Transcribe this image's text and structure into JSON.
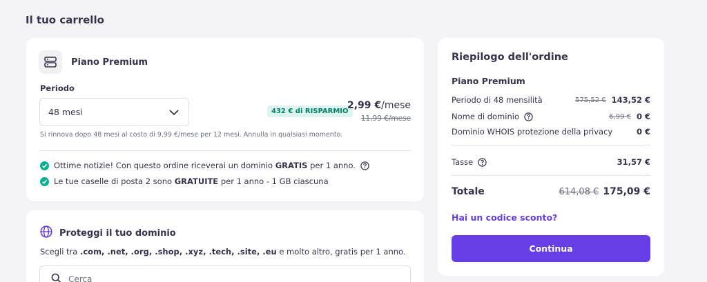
{
  "page": {
    "title": "Il tuo carrello"
  },
  "plan": {
    "name": "Piano Premium",
    "period_label": "Periodo",
    "period_value": "48 mesi",
    "savings_badge": "432 € di RISPARMIO",
    "price": "2,99 €",
    "price_unit": "/mese",
    "old_price": "11,99 €/mese",
    "renew_note": "Si rinnova dopo 48 mesi al costo di 9,99 €/mese per 12 mesi. Annulla in qualsiasi momento.",
    "perks": [
      {
        "pre": "Ottime notizie! Con questo ordine riceverai un dominio ",
        "bold": "GRATIS",
        "post": " per 1 anno."
      },
      {
        "pre": "Le tue caselle di posta 2 sono ",
        "bold": "GRATUITE",
        "post": " per 1 anno - 1 GB ciascuna"
      }
    ]
  },
  "domain": {
    "title": "Proteggi il tuo dominio",
    "desc_pre": "Scegli tra ",
    "desc_bold": ".com, .net, .org, .shop, .xyz, .tech, .site, .eu",
    "desc_post": " e molto altro, gratis per 1 anno.",
    "search_placeholder": "Cerca"
  },
  "summary": {
    "title": "Riepilogo dell'ordine",
    "plan_name": "Piano Premium",
    "rows": [
      {
        "label": "Periodo di 48 mensilità",
        "old": "575,52 €",
        "value": "143,52 €"
      },
      {
        "label": "Nome di dominio",
        "old": "6,99 €",
        "value": "0 €"
      },
      {
        "label": "Dominio WHOIS protezione della privacy",
        "old": "",
        "value": "0 €"
      }
    ],
    "tax": {
      "label": "Tasse",
      "value": "31,57 €"
    },
    "total": {
      "label": "Totale",
      "old": "614,08 €",
      "value": "175,09 €"
    },
    "coupon_link": "Hai un codice sconto?",
    "continue_label": "Continua"
  },
  "colors": {
    "accent": "#673de6",
    "success": "#00b090",
    "badge_bg": "#def4f0",
    "badge_text": "#008361",
    "text": "#36344d"
  }
}
